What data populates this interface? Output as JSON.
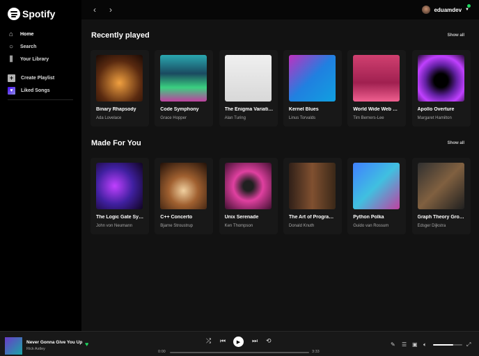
{
  "app": {
    "name": "Spotify"
  },
  "sidebar": {
    "items": [
      {
        "label": "Home",
        "icon": "home-icon"
      },
      {
        "label": "Search",
        "icon": "search-icon"
      },
      {
        "label": "Your Library",
        "icon": "library-icon"
      },
      {
        "label": "Create Playlist",
        "icon": "plus-icon"
      },
      {
        "label": "Liked Songs",
        "icon": "heart-icon"
      }
    ]
  },
  "header": {
    "username": "eduamdev"
  },
  "sections": [
    {
      "title": "Recently played",
      "show_all": "Show all",
      "cards": [
        {
          "title": "Binary Rhapsody",
          "subtitle": "Ada Lovelace"
        },
        {
          "title": "Code Symphony",
          "subtitle": "Grace Hopper"
        },
        {
          "title": "The Enigma Variations",
          "subtitle": "Alan Turing"
        },
        {
          "title": "Kernel Blues",
          "subtitle": "Linus Torvalds"
        },
        {
          "title": "World Wide Web Waltz",
          "subtitle": "Tim Berners-Lee"
        },
        {
          "title": "Apollo Overture",
          "subtitle": "Margaret Hamilton"
        }
      ]
    },
    {
      "title": "Made For You",
      "show_all": "Show all",
      "cards": [
        {
          "title": "The Logic Gate Symphony",
          "subtitle": "John von Neumann"
        },
        {
          "title": "C++ Concerto",
          "subtitle": "Bjarne Stroustrup"
        },
        {
          "title": "Unix Serenade",
          "subtitle": "Ken Thompson"
        },
        {
          "title": "The Art of Programming",
          "subtitle": "Donald Knuth"
        },
        {
          "title": "Python Polka",
          "subtitle": "Guido van Rossum"
        },
        {
          "title": "Graph Theory Groove",
          "subtitle": "Edsger Dijkstra"
        }
      ]
    }
  ],
  "player": {
    "title": "Never Gonna Give You Up",
    "artist": "Rick Astley",
    "elapsed": "0:00",
    "duration": "3:33",
    "progress": 0,
    "volume": 0.7
  },
  "colors": {
    "accent": "#1ed760",
    "background": "#121212"
  }
}
